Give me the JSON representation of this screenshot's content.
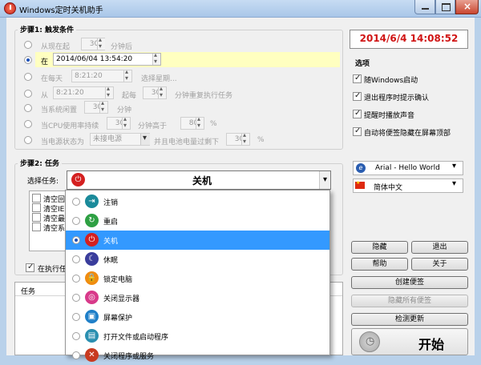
{
  "window": {
    "title": "Windows定时关机助手"
  },
  "clock": {
    "text": "2014/6/4 14:08:52",
    "color": "#d01414"
  },
  "step1": {
    "label": "步骤1: 触发条件",
    "from_now": {
      "label": "从现在起",
      "value": "30",
      "unit": "分钟后"
    },
    "at": {
      "label": "在",
      "value": "2014/06/04  13:54:20"
    },
    "every_day": {
      "label": "在每天",
      "value": "8:21:20",
      "select_week": "选择星期..."
    },
    "from": {
      "label": "从",
      "value": "8:21:20",
      "start": "起每",
      "interval": "30",
      "unit": "分钟重复执行任务"
    },
    "idle": {
      "label": "当系统闲置",
      "value": "30",
      "unit": "分钟"
    },
    "cpu": {
      "label": "当CPU使用率持续",
      "value": "30",
      "mid": "分钟高于",
      "percent": "80",
      "unit": "%"
    },
    "power": {
      "label": "当电源状态为",
      "value": "未接电源",
      "mid": "并且电池电量过剩下",
      "percent": "30",
      "unit": "%"
    }
  },
  "options": {
    "label": "选项",
    "items": [
      {
        "label": "随Windows启动",
        "checked": true
      },
      {
        "label": "退出程序时提示确认",
        "checked": true
      },
      {
        "label": "提醒时播放声音",
        "checked": true
      },
      {
        "label": "自动将便签隐藏在屏幕顶部",
        "checked": true
      }
    ],
    "font_select": "Arial  - Hello World",
    "language_select": "简体中文"
  },
  "step2": {
    "label": "步骤2: 任务",
    "select_label": "选择任务:",
    "selected_task": "关机",
    "clear_items": [
      "清空回",
      "清空IE",
      "清空最",
      "清空系"
    ],
    "when_run": "在执行任"
  },
  "task_menu": [
    {
      "label": "注销",
      "icon": "logoff-icon",
      "color": "#1a8a9a",
      "glyph": "⇥",
      "selected": false
    },
    {
      "label": "重启",
      "icon": "restart-icon",
      "color": "#2ea043",
      "glyph": "↻",
      "selected": false
    },
    {
      "label": "关机",
      "icon": "power-icon",
      "color": "#d42020",
      "glyph": "⏻",
      "selected": true
    },
    {
      "label": "休眠",
      "icon": "sleep-moon-icon",
      "color": "#3a3d9c",
      "glyph": "☾",
      "selected": false
    },
    {
      "label": "锁定电脑",
      "icon": "lock-icon",
      "color": "#f08c10",
      "glyph": "🔒",
      "selected": false
    },
    {
      "label": "关闭显示器",
      "icon": "monitor-off-icon",
      "color": "#d83a8a",
      "glyph": "◎",
      "selected": false
    },
    {
      "label": "屏幕保护",
      "icon": "screensaver-icon",
      "color": "#1f7fc8",
      "glyph": "▣",
      "selected": false
    },
    {
      "label": "打开文件或启动程序",
      "icon": "open-program-icon",
      "color": "#2a8fb0",
      "glyph": "▤",
      "selected": false
    },
    {
      "label": "关闭程序或服务",
      "icon": "close-program-icon",
      "color": "#c83a20",
      "glyph": "✕",
      "selected": false
    }
  ],
  "task_list": {
    "header": "任务"
  },
  "buttons": {
    "hide": "隐藏",
    "exit": "退出",
    "help": "帮助",
    "about": "关于",
    "create_note": "创建便签",
    "hide_all_notes": "隐藏所有便签",
    "check_update": "检测更新",
    "start": "开始"
  }
}
